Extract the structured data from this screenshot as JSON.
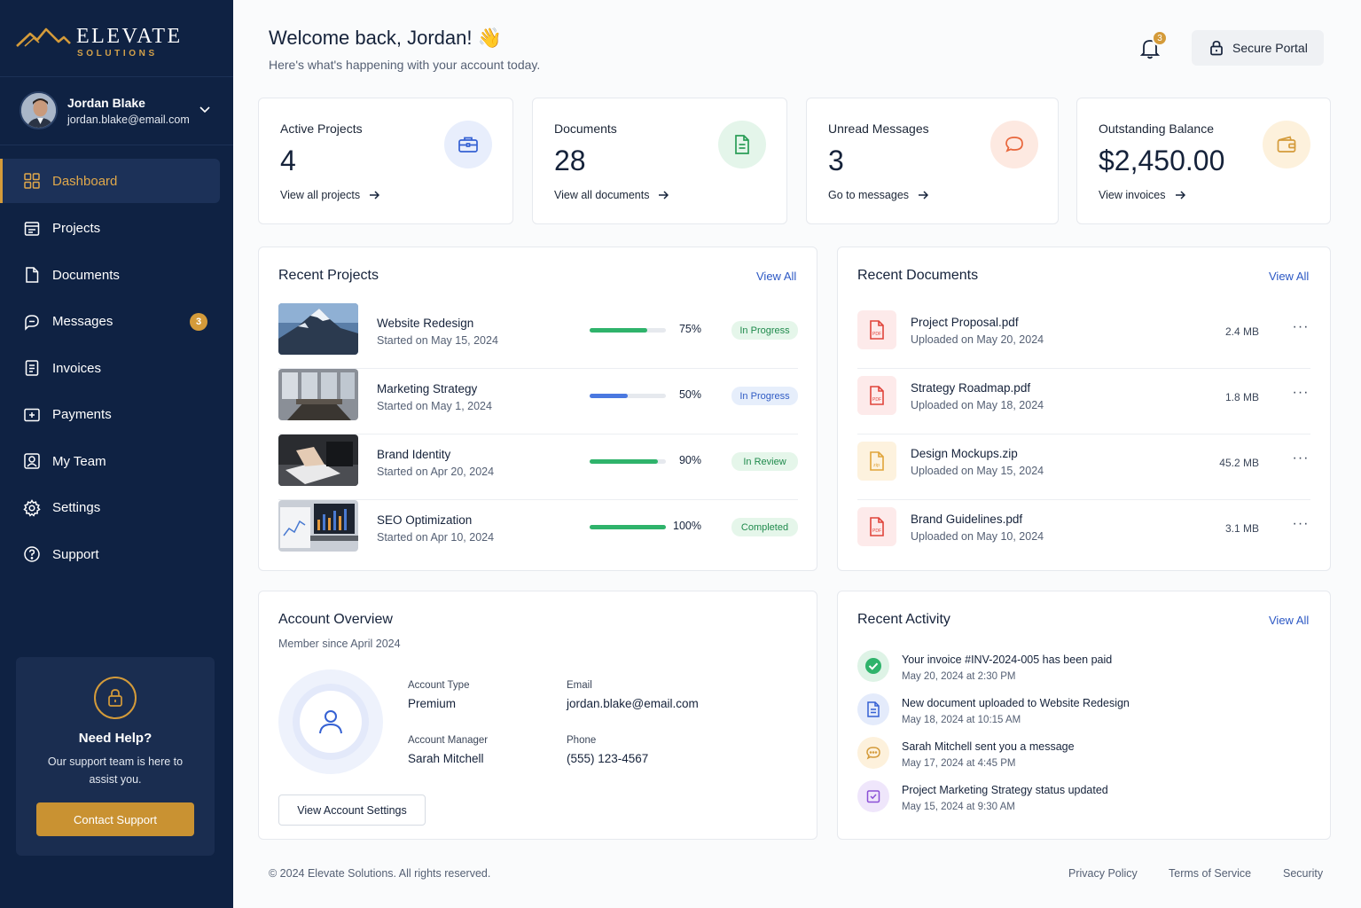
{
  "brand": {
    "name": "ELEVATE",
    "sub": "SOLUTIONS",
    "accent": "#d49b3a",
    "navy": "#0f2243"
  },
  "user": {
    "name": "Jordan Blake",
    "email": "jordan.blake@email.com"
  },
  "nav": [
    {
      "label": "Dashboard",
      "icon": "grid-icon",
      "active": true
    },
    {
      "label": "Projects",
      "icon": "projects-icon"
    },
    {
      "label": "Documents",
      "icon": "document-icon"
    },
    {
      "label": "Messages",
      "icon": "chat-icon",
      "badge": "3"
    },
    {
      "label": "Invoices",
      "icon": "invoice-icon"
    },
    {
      "label": "Payments",
      "icon": "payment-icon"
    },
    {
      "label": "My Team",
      "icon": "team-icon"
    },
    {
      "label": "Settings",
      "icon": "gear-icon"
    },
    {
      "label": "Support",
      "icon": "help-icon"
    }
  ],
  "help": {
    "title": "Need Help?",
    "text": "Our support team is here to assist you.",
    "button": "Contact Support"
  },
  "header": {
    "title": "Welcome back, Jordan! 👋",
    "subtitle": "Here's what's happening with your account today.",
    "notifications": "3",
    "portal_label": "Secure Portal"
  },
  "stats": [
    {
      "label": "Active Projects",
      "value": "4",
      "link": "View all projects",
      "icon": "briefcase-icon"
    },
    {
      "label": "Documents",
      "value": "28",
      "link": "View all documents",
      "icon": "document-icon"
    },
    {
      "label": "Unread Messages",
      "value": "3",
      "link": "Go to messages",
      "icon": "chat-icon"
    },
    {
      "label": "Outstanding Balance",
      "value": "$2,450.00",
      "link": "View invoices",
      "icon": "wallet-icon"
    }
  ],
  "projects": {
    "title": "Recent Projects",
    "view_all": "View All",
    "items": [
      {
        "name": "Website Redesign",
        "date": "Started on May 15, 2024",
        "progress": 75,
        "pct": "75%",
        "status": "In Progress",
        "color": "#2fb36b",
        "badge_bg": "#e5f6ea",
        "badge_fg": "#1f8a4c"
      },
      {
        "name": "Marketing Strategy",
        "date": "Started on May 1, 2024",
        "progress": 50,
        "pct": "50%",
        "status": "In Progress",
        "color": "#4a78e0",
        "badge_bg": "#e6eefb",
        "badge_fg": "#2f5bc4"
      },
      {
        "name": "Brand Identity",
        "date": "Started on Apr 20, 2024",
        "progress": 90,
        "pct": "90%",
        "status": "In Review",
        "color": "#2fb36b",
        "badge_bg": "#e5f6ea",
        "badge_fg": "#1f8a4c"
      },
      {
        "name": "SEO Optimization",
        "date": "Started on Apr 10, 2024",
        "progress": 100,
        "pct": "100%",
        "status": "Completed",
        "color": "#2fb36b",
        "badge_bg": "#e5f6ea",
        "badge_fg": "#1f8a4c"
      }
    ]
  },
  "documents": {
    "title": "Recent Documents",
    "view_all": "View All",
    "items": [
      {
        "name": "Project Proposal.pdf",
        "date": "Uploaded on May 20, 2024",
        "size": "2.4 MB",
        "type": "pdf"
      },
      {
        "name": "Strategy Roadmap.pdf",
        "date": "Uploaded on May 18, 2024",
        "size": "1.8 MB",
        "type": "pdf"
      },
      {
        "name": "Design Mockups.zip",
        "date": "Uploaded on May 15, 2024",
        "size": "45.2 MB",
        "type": "zip"
      },
      {
        "name": "Brand Guidelines.pdf",
        "date": "Uploaded on May 10, 2024",
        "size": "3.1 MB",
        "type": "pdf"
      }
    ]
  },
  "overview": {
    "title": "Account Overview",
    "subtitle": "Member since April 2024",
    "account_type_label": "Account Type",
    "account_type": "Premium",
    "email_label": "Email",
    "email": "jordan.blake@email.com",
    "manager_label": "Account Manager",
    "manager": "Sarah Mitchell",
    "phone_label": "Phone",
    "phone": "(555) 123-4567",
    "button": "View Account Settings"
  },
  "activity": {
    "title": "Recent Activity",
    "view_all": "View All",
    "items": [
      {
        "text": "Your invoice #INV-2024-005 has been paid",
        "time": "May 20, 2024 at 2:30 PM",
        "icon": "check-icon"
      },
      {
        "text": "New document uploaded to Website Redesign",
        "time": "May 18, 2024 at 10:15 AM",
        "icon": "document-icon"
      },
      {
        "text": "Sarah Mitchell sent you a message",
        "time": "May 17, 2024 at 4:45 PM",
        "icon": "chat-icon"
      },
      {
        "text": "Project Marketing Strategy status updated",
        "time": "May 15, 2024 at 9:30 AM",
        "icon": "status-icon"
      }
    ]
  },
  "footer": {
    "copyright": "© 2024 Elevate Solutions. All rights reserved.",
    "links": [
      "Privacy Policy",
      "Terms of Service",
      "Security"
    ]
  }
}
